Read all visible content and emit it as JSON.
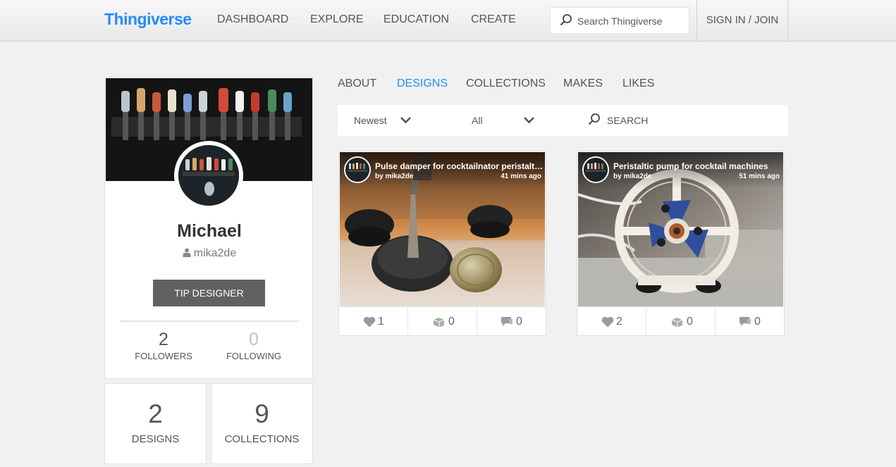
{
  "header": {
    "logo": "Thingiverse",
    "nav": [
      "DASHBOARD",
      "EXPLORE",
      "EDUCATION",
      "CREATE"
    ],
    "search_placeholder": "Search Thingiverse",
    "signin": "SIGN IN / JOIN"
  },
  "profile": {
    "name": "Michael",
    "username": "mika2de",
    "tip_button": "TIP DESIGNER",
    "followers_count": "2",
    "followers_label": "FOLLOWERS",
    "following_count": "0",
    "following_label": "FOLLOWING",
    "designs_count": "2",
    "designs_label": "DESIGNS",
    "collections_count": "9",
    "collections_label": "COLLECTIONS"
  },
  "tabs": [
    "ABOUT",
    "DESIGNS",
    "COLLECTIONS",
    "MAKES",
    "LIKES"
  ],
  "active_tab": "DESIGNS",
  "filters": {
    "sort": "Newest",
    "type": "All",
    "search_placeholder": "SEARCH"
  },
  "things": [
    {
      "title": "Pulse damper for cocktailnator peristaltic pump",
      "by": "by mika2de",
      "time": "41 mins ago",
      "likes": "1",
      "collects": "0",
      "comments": "0"
    },
    {
      "title": "Peristaltic pump for cocktail machines",
      "by": "by mika2de",
      "time": "51 mins ago",
      "likes": "2",
      "collects": "0",
      "comments": "0"
    }
  ],
  "colors": {
    "accent": "#248bfb",
    "tip_button": "#616161",
    "background": "#f1f1f1"
  },
  "icons": [
    "search-icon",
    "user-icon",
    "chevron-down-icon",
    "heart-icon",
    "collect-icon",
    "comment-icon"
  ]
}
